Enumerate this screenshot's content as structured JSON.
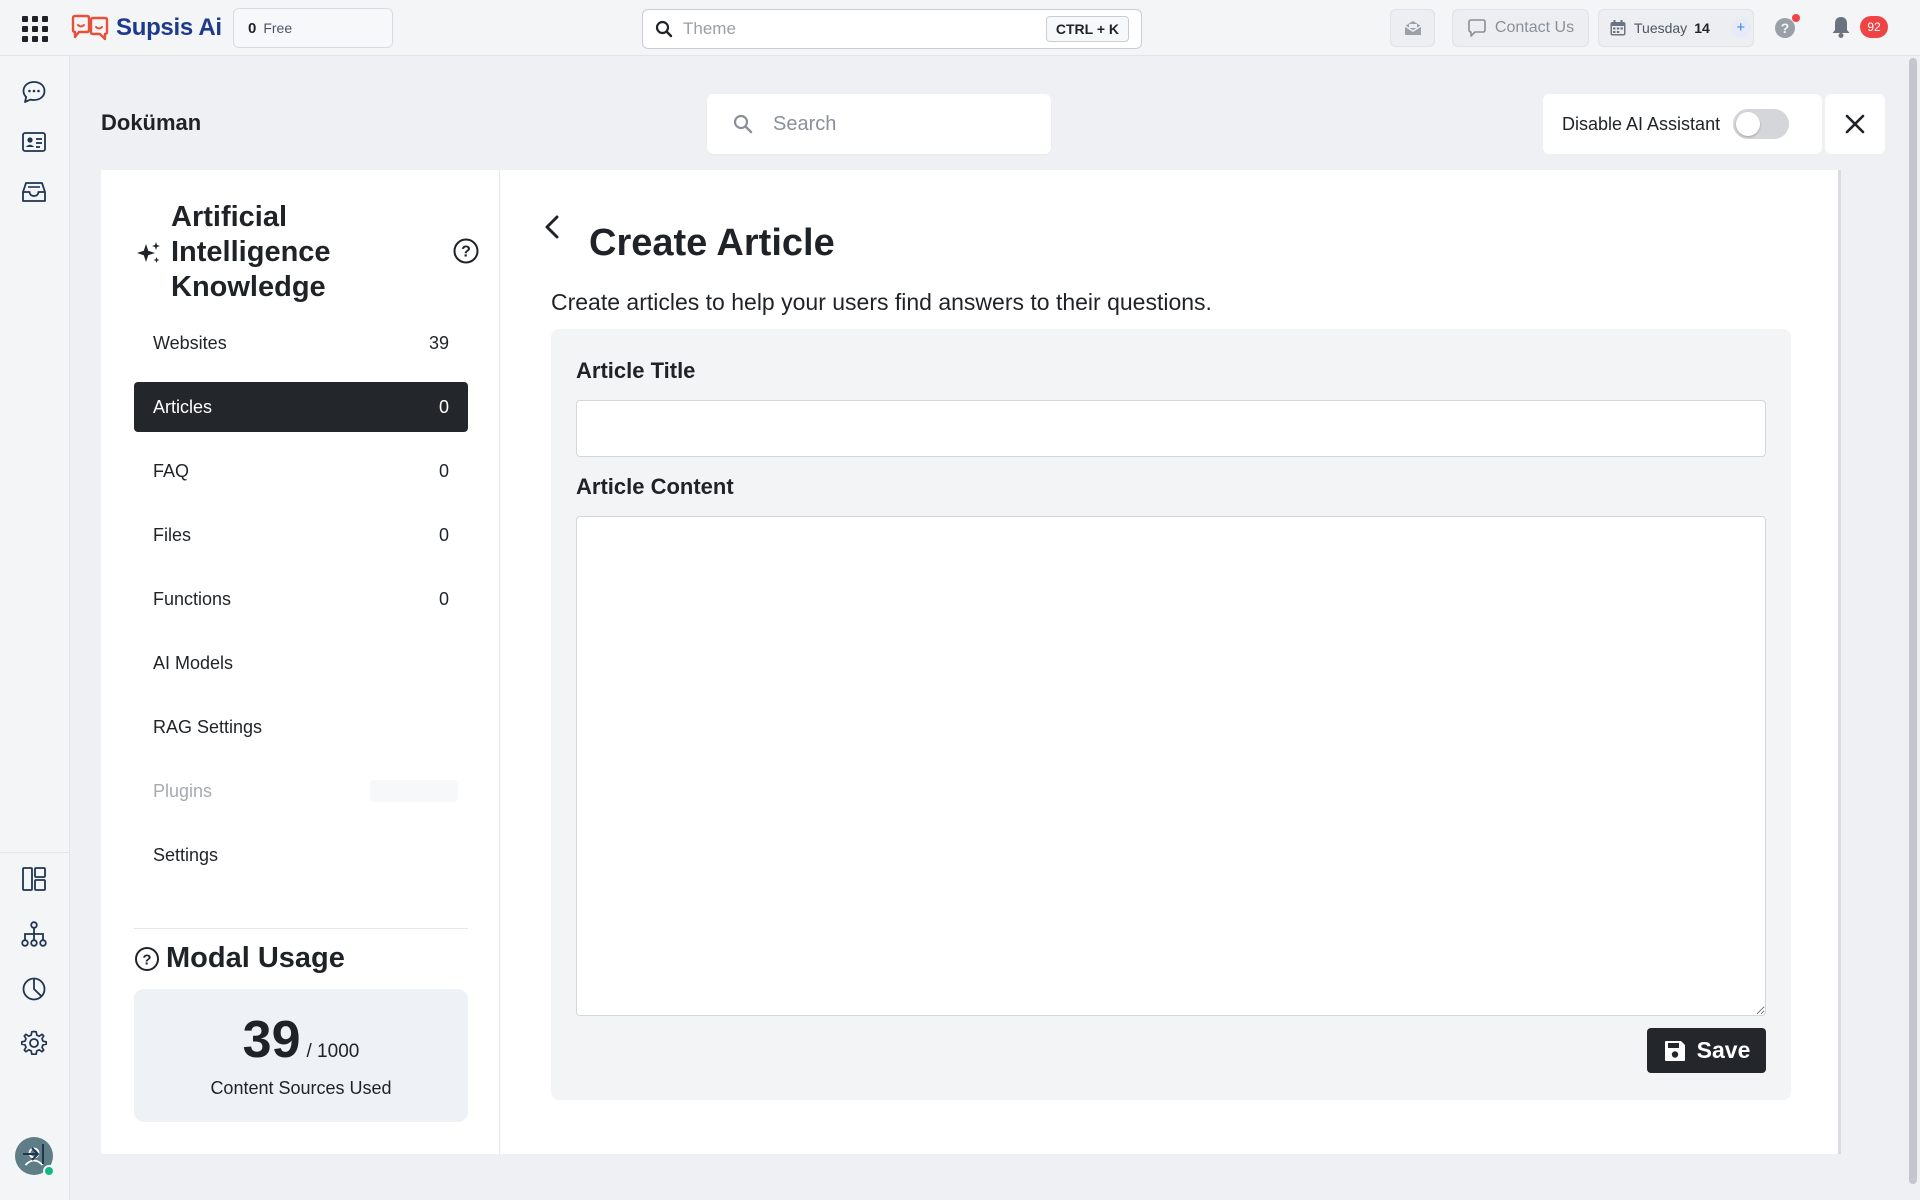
{
  "topbar": {
    "logo_text": "Supsis Ai",
    "credits_count": "0",
    "credits_label": "Free",
    "search_value": "Theme",
    "search_shortcut": "CTRL + K",
    "contact_label": "Contact Us",
    "date_day": "Tuesday",
    "date_num": "14",
    "notification_count": "92"
  },
  "page": {
    "title": "Doküman",
    "search_placeholder": "Search",
    "ai_toggle_label": "Disable AI Assistant",
    "ai_toggle_on": false
  },
  "knowledge": {
    "title": "Artificial Intelligence Knowledge",
    "items": [
      {
        "label": "Websites",
        "count": "39"
      },
      {
        "label": "Articles",
        "count": "0"
      },
      {
        "label": "FAQ",
        "count": "0"
      },
      {
        "label": "Files",
        "count": "0"
      },
      {
        "label": "Functions",
        "count": "0"
      },
      {
        "label": "AI Models",
        "count": ""
      },
      {
        "label": "RAG Settings",
        "count": ""
      },
      {
        "label": "Plugins",
        "count": ""
      },
      {
        "label": "Settings",
        "count": ""
      }
    ],
    "active_item": "Articles",
    "usage": {
      "title": "Modal Usage",
      "used": "39",
      "limit": "/ 1000",
      "label": "Content Sources Used"
    }
  },
  "article": {
    "heading": "Create Article",
    "subtitle": "Create articles to help your users find answers to their questions.",
    "title_label": "Article Title",
    "title_value": "",
    "content_label": "Article Content",
    "content_value": "",
    "save_label": "Save"
  },
  "colors": {
    "accent_dark": "#23262b",
    "badge_red": "#ef4444",
    "brand_blue": "#1e3a8a",
    "brand_red": "#e8503a"
  },
  "icons": [
    "apps-grid-icon",
    "supsis-logo-icon",
    "search-icon",
    "mail-icon",
    "chat-bubble-icon",
    "calendar-icon",
    "plus-icon",
    "help-circle-icon",
    "bell-icon",
    "chat-icon",
    "contact-card-icon",
    "inbox-icon",
    "dashboard-icon",
    "hierarchy-icon",
    "pie-chart-icon",
    "gear-icon",
    "avatar",
    "logout-icon",
    "sparkles-icon",
    "back-arrow-icon",
    "close-icon",
    "save-disk-icon"
  ]
}
